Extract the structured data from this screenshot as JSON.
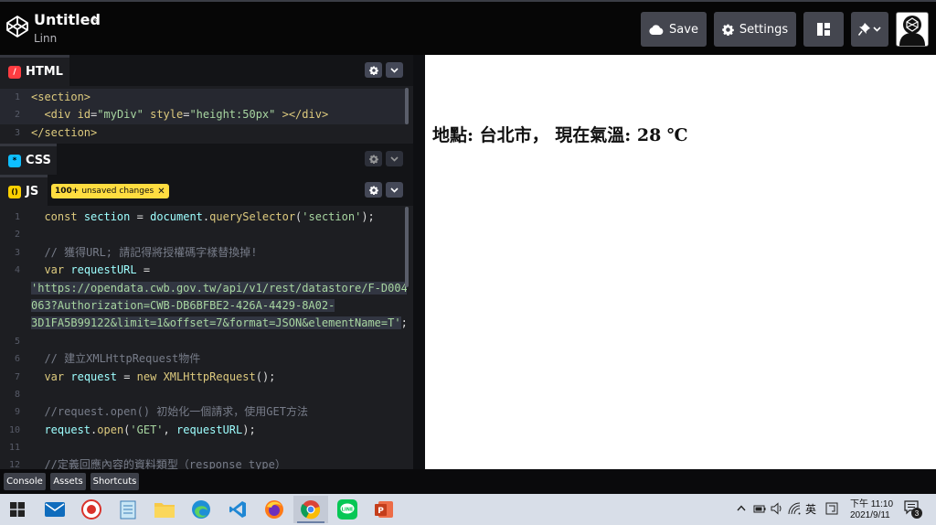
{
  "header": {
    "title": "Untitled",
    "author": "Linn",
    "save_label": "Save",
    "settings_label": "Settings"
  },
  "panels": {
    "html": {
      "label": "HTML",
      "icon": "/",
      "lines": [
        {
          "n": "1",
          "html": "<span class=\"tagc\">&lt;section&gt;</span>"
        },
        {
          "n": "2",
          "html": "  <span class=\"tagc\">&lt;div</span> <span class=\"attr\">id</span><span class=\"pl\">=</span><span class=\"strv\">\"myDiv\"</span> <span class=\"attr\">style</span><span class=\"pl\">=</span><span class=\"strv\">\"height:50px\"</span> <span class=\"tagc\">&gt;&lt;/div&gt;</span>"
        },
        {
          "n": "3",
          "html": "<span class=\"tagc\">&lt;/section&gt;</span>"
        }
      ]
    },
    "css": {
      "label": "CSS",
      "icon": "*"
    },
    "js": {
      "label": "JS",
      "icon": "()",
      "badge_count": "100+",
      "badge_text": "unsaved changes",
      "lines": [
        {
          "n": "1",
          "html": "  <span class=\"kw\">const</span> <span class=\"var\">section</span> <span class=\"pl\">=</span> <span class=\"var\">document</span><span class=\"pl\">.</span><span class=\"fn\">querySelector</span><span class=\"pl\">(</span><span class=\"str\">'section'</span><span class=\"pl\">);</span>"
        },
        {
          "n": "2",
          "html": ""
        },
        {
          "n": "3",
          "html": "  <span class=\"cmt\">// 獲得URL; 請記得將授權碼字樣替換掉!</span>"
        },
        {
          "n": "4",
          "html": "  <span class=\"kw\">var</span> <span class=\"var\">requestURL</span> <span class=\"pl\">=</span>"
        },
        {
          "n": "",
          "html": "<span class=\"str sel\">'https://opendata.cwb.gov.tw/api/v1/rest/datastore/F-D0047-</span>"
        },
        {
          "n": "",
          "html": "<span class=\"str sel\">063?Authorization=CWB-DB6BFBE2-426A-4429-8A02-</span>"
        },
        {
          "n": "",
          "html": "<span class=\"str sel\">3D1FA5B99122&amp;limit=1&amp;offset=7&amp;format=JSON&amp;elementName=T'</span><span class=\"pl\">;</span>"
        },
        {
          "n": "5",
          "html": ""
        },
        {
          "n": "6",
          "html": "  <span class=\"cmt\">// 建立XMLHttpRequest物件</span>"
        },
        {
          "n": "7",
          "html": "  <span class=\"kw\">var</span> <span class=\"var\">request</span> <span class=\"pl\">=</span> <span class=\"kw\">new</span> <span class=\"fn\">XMLHttpRequest</span><span class=\"pl\">();</span>"
        },
        {
          "n": "8",
          "html": ""
        },
        {
          "n": "9",
          "html": "  <span class=\"cmt\">//request.open() 初始化一個請求，使用GET方法</span>"
        },
        {
          "n": "10",
          "html": "  <span class=\"var\">request</span><span class=\"pl\">.</span><span class=\"fn\">open</span><span class=\"pl\">(</span><span class=\"str\">'GET'</span><span class=\"pl\">,</span> <span class=\"var\">requestURL</span><span class=\"pl\">);</span>"
        },
        {
          "n": "11",
          "html": ""
        },
        {
          "n": "12",
          "html": "  <span class=\"cmt\">//定義回應內容的資料類型（response type）</span>"
        }
      ]
    }
  },
  "preview": {
    "output": "地點: 台北市，  現在氣溫: 28 ℃"
  },
  "footer": {
    "console": "Console",
    "assets": "Assets",
    "shortcuts": "Shortcuts"
  },
  "taskbar": {
    "apps": [
      "windows-start",
      "mail",
      "screen-recorder",
      "notepad",
      "file-explorer",
      "edge",
      "vscode",
      "firefox",
      "chrome",
      "line",
      "powerpoint"
    ],
    "ime": "英",
    "time": "下午 11:10",
    "date": "2021/9/11",
    "notification_count": "3"
  }
}
